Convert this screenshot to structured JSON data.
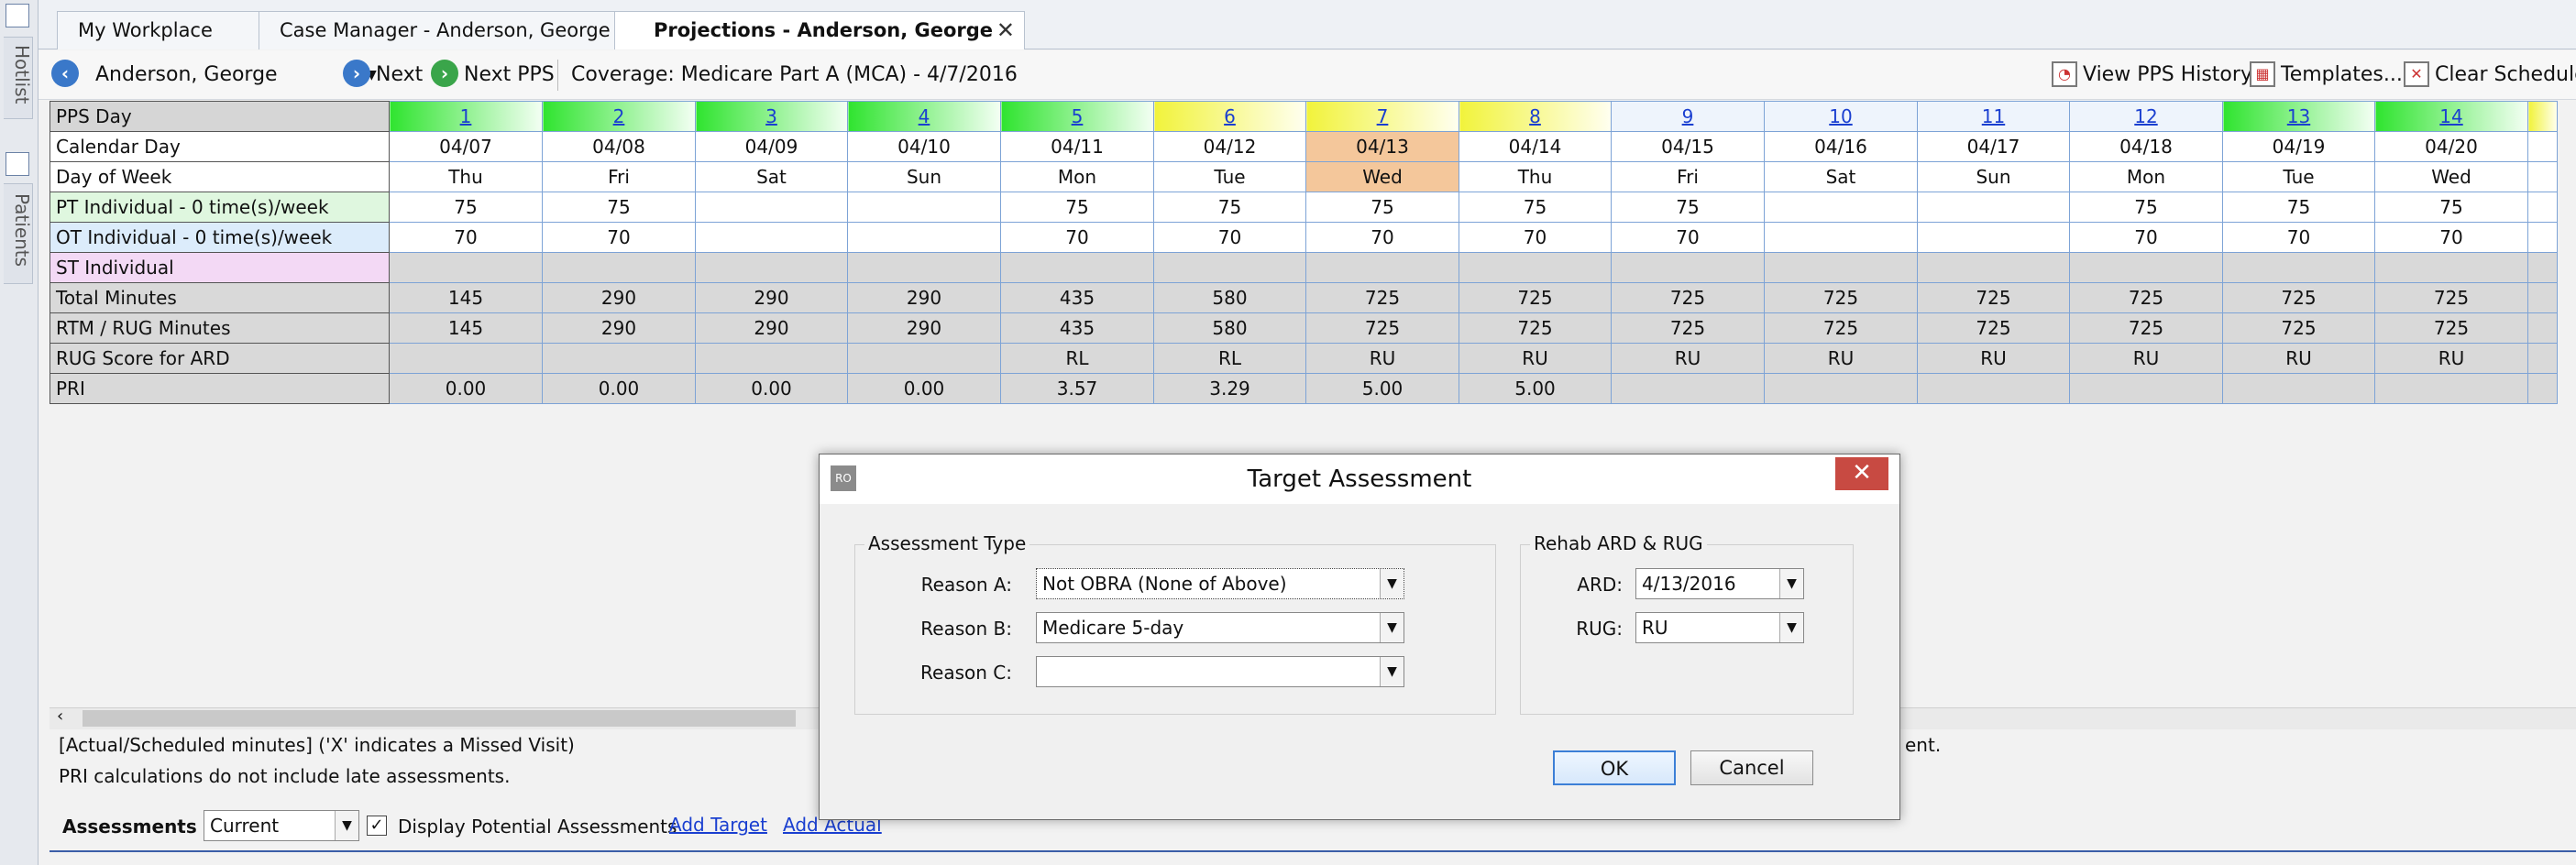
{
  "rail": {
    "hotlist_label": "Hotlist",
    "patients_label": "Patients"
  },
  "tabs": [
    {
      "label": "My Workplace"
    },
    {
      "label": "Case Manager - Anderson, George"
    },
    {
      "label": "Projections - Anderson, George"
    }
  ],
  "toolbar": {
    "patient": "Anderson, George",
    "next": "Next",
    "next_pps": "Next PPS",
    "coverage": "Coverage: Medicare Part A  (MCA) - 4/7/2016",
    "view_pps_history": "View PPS History",
    "templates": "Templates...",
    "clear_schedule": "Clear Schedule..."
  },
  "grid": {
    "row_labels": [
      "PPS Day",
      "Calendar Day",
      "Day of Week",
      "PT Individual - 0 time(s)/week",
      "OT Individual - 0 time(s)/week",
      "ST Individual",
      "Total Minutes",
      "RTM / RUG Minutes",
      "RUG Score for ARD",
      "PRI"
    ],
    "pps_day": [
      "1",
      "2",
      "3",
      "4",
      "5",
      "6",
      "7",
      "8",
      "9",
      "10",
      "11",
      "12",
      "13",
      "14"
    ],
    "calendar_day": [
      "04/07",
      "04/08",
      "04/09",
      "04/10",
      "04/11",
      "04/12",
      "04/13",
      "04/14",
      "04/15",
      "04/16",
      "04/17",
      "04/18",
      "04/19",
      "04/20"
    ],
    "day_of_week": [
      "Thu",
      "Fri",
      "Sat",
      "Sun",
      "Mon",
      "Tue",
      "Wed",
      "Thu",
      "Fri",
      "Sat",
      "Sun",
      "Mon",
      "Tue",
      "Wed"
    ],
    "pt": [
      "75",
      "75",
      "",
      "",
      "75",
      "75",
      "75",
      "75",
      "75",
      "",
      "",
      "75",
      "75",
      "75"
    ],
    "ot": [
      "70",
      "70",
      "",
      "",
      "70",
      "70",
      "70",
      "70",
      "70",
      "",
      "",
      "70",
      "70",
      "70"
    ],
    "st": [
      "",
      "",
      "",
      "",
      "",
      "",
      "",
      "",
      "",
      "",
      "",
      "",
      "",
      ""
    ],
    "total": [
      "145",
      "290",
      "290",
      "290",
      "435",
      "580",
      "725",
      "725",
      "725",
      "725",
      "725",
      "725",
      "725",
      "725"
    ],
    "rtm": [
      "145",
      "290",
      "290",
      "290",
      "435",
      "580",
      "725",
      "725",
      "725",
      "725",
      "725",
      "725",
      "725",
      "725"
    ],
    "rug_score": [
      "",
      "",
      "",
      "",
      "RL",
      "RL",
      "RU",
      "RU",
      "RU",
      "RU",
      "RU",
      "RU",
      "RU",
      "RU"
    ],
    "pri": [
      "0.00",
      "0.00",
      "0.00",
      "0.00",
      "3.57",
      "3.29",
      "5.00",
      "5.00",
      "",
      "",
      "",
      "",
      "",
      ""
    ]
  },
  "notes": {
    "line1": "[Actual/Scheduled minutes] ('X' indicates a Missed Visit)",
    "line2": "PRI calculations do not include late assessments.",
    "line1_tail": "ent."
  },
  "assessments": {
    "label": "Assessments",
    "filter": "Current",
    "display_potential": "Display Potential Assessments",
    "display_potential_checked": true,
    "add_target": "Add Target",
    "add_actual": "Add Actual"
  },
  "dialog": {
    "title": "Target Assessment",
    "icon": "RO",
    "assessment_type_label": "Assessment Type",
    "reason_a_label": "Reason A:",
    "reason_a": "Not OBRA (None of Above)",
    "reason_b_label": "Reason B:",
    "reason_b": "Medicare 5-day",
    "reason_c_label": "Reason C:",
    "reason_c": "",
    "rehab_label": "Rehab ARD & RUG",
    "ard_label": "ARD:",
    "ard": "4/13/2016",
    "rug_label": "RUG:",
    "rug": "RU",
    "ok": "OK",
    "cancel": "Cancel"
  }
}
